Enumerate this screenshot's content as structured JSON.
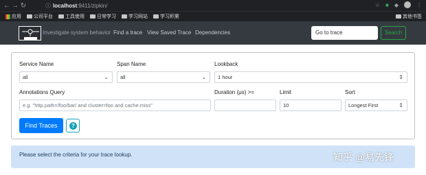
{
  "browser": {
    "url_host": "localhost",
    "url_path": ":9411/zipkin/",
    "bookmarks": [
      {
        "label": "应用"
      },
      {
        "label": "公司平台"
      },
      {
        "label": "工具使用"
      },
      {
        "label": "日常学习"
      },
      {
        "label": "学习网站"
      },
      {
        "label": "学习积累"
      }
    ],
    "other_bookmarks": "其他书签"
  },
  "navbar": {
    "tagline": "Investigate system behavior",
    "links": [
      "Find a trace",
      "View Saved Trace",
      "Dependencies"
    ],
    "goto_placeholder": "Go to trace",
    "search_label": "Search"
  },
  "form": {
    "service_name": {
      "label": "Service Name",
      "value": "all"
    },
    "span_name": {
      "label": "Span Name",
      "value": "all"
    },
    "lookback": {
      "label": "Lookback",
      "value": "1 hour"
    },
    "annotations": {
      "label": "Annotations Query",
      "placeholder": "e.g. \"http.path=/foo/bar/ and cluster=foo and cache.miss\""
    },
    "duration": {
      "label": "Duration (μs) >=",
      "value": ""
    },
    "limit": {
      "label": "Limit",
      "value": "10"
    },
    "sort": {
      "label": "Sort",
      "value": "Longest First"
    },
    "find_label": "Find Traces",
    "help_label": "?"
  },
  "info": {
    "text": "Please select the criteria for your trace lookup."
  },
  "watermark": "知乎 @易先锋"
}
